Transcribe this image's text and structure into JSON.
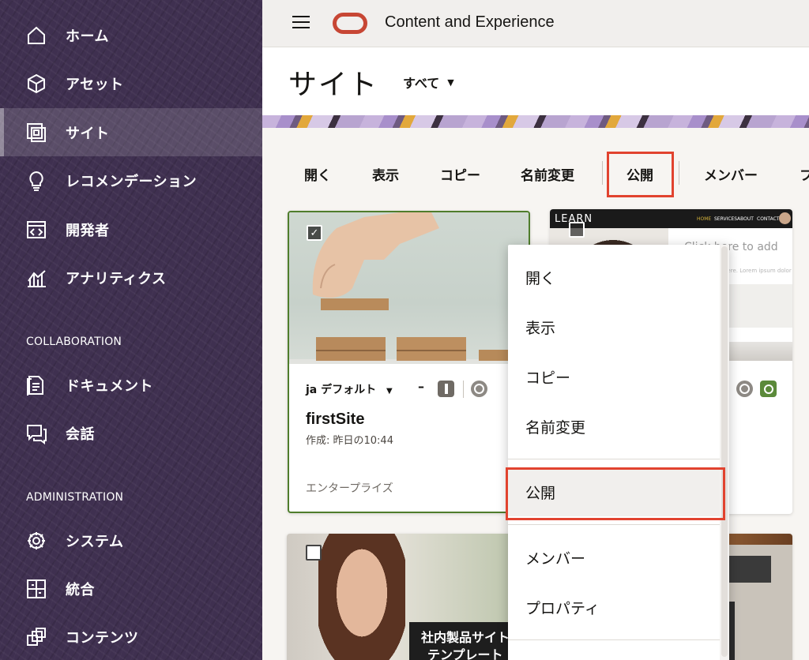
{
  "sidebar": {
    "items": [
      {
        "label": "ホーム",
        "icon": "home-icon"
      },
      {
        "label": "アセット",
        "icon": "cube-icon"
      },
      {
        "label": "サイト",
        "icon": "sites-icon"
      },
      {
        "label": "レコメンデーション",
        "icon": "lightbulb-icon"
      },
      {
        "label": "開発者",
        "icon": "code-window-icon"
      },
      {
        "label": "アナリティクス",
        "icon": "analytics-icon"
      }
    ],
    "collaboration_label": "COLLABORATION",
    "collaboration_items": [
      {
        "label": "ドキュメント",
        "icon": "documents-icon"
      },
      {
        "label": "会話",
        "icon": "conversation-icon"
      }
    ],
    "administration_label": "ADMINISTRATION",
    "administration_items": [
      {
        "label": "システム",
        "icon": "gear-icon"
      },
      {
        "label": "統合",
        "icon": "integration-icon"
      },
      {
        "label": "コンテンツ",
        "icon": "content-icon"
      }
    ]
  },
  "header": {
    "app_title": "Content and Experience",
    "page_title": "サイト",
    "filter_label": "すべて"
  },
  "toolbar": {
    "open": "開く",
    "view": "表示",
    "copy": "コピー",
    "rename": "名前変更",
    "publish": "公開",
    "members": "メンバー",
    "overflow": "フ"
  },
  "cards": {
    "first": {
      "language": "ja デフォルト",
      "name": "firstSite",
      "created": "作成: 昨日の10:44",
      "type": "エンタープライズ",
      "status_dash": "–"
    },
    "second": {
      "preview_brand": "LEARN",
      "preview_nav": [
        "HOME",
        "SERVICES",
        "ABOUT",
        "CONTACT"
      ],
      "preview_text": "Click here to add",
      "preview_small": "here. Lorem ipsum dolor"
    },
    "third": {
      "overlay_line1": "社内製品サイト",
      "overlay_line2": "テンプレート"
    }
  },
  "menu": {
    "items": [
      "開く",
      "表示",
      "コピー",
      "名前変更",
      "公開",
      "メンバー",
      "プロパティ"
    ]
  },
  "colors": {
    "sidebar_bg": "#3f3050",
    "highlight": "#e1432f",
    "selected_border": "#4f7d2c",
    "oracle_red": "#c74634"
  }
}
